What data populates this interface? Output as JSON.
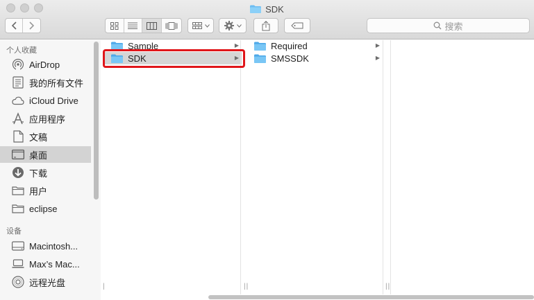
{
  "window": {
    "title": "SDK"
  },
  "toolbar": {
    "back_icon": "chevron-left-icon",
    "forward_icon": "chevron-right-icon",
    "view_modes": [
      "icon-view",
      "list-view",
      "column-view",
      "cover-flow-view"
    ],
    "active_view": "column-view",
    "search_placeholder": "搜索"
  },
  "sidebar": {
    "favorites_header": "个人收藏",
    "favorites": [
      {
        "label": "AirDrop",
        "icon": "airdrop-icon"
      },
      {
        "label": "我的所有文件",
        "icon": "all-files-icon"
      },
      {
        "label": "iCloud Drive",
        "icon": "cloud-icon"
      },
      {
        "label": "应用程序",
        "icon": "applications-icon"
      },
      {
        "label": "文稿",
        "icon": "document-icon"
      },
      {
        "label": "桌面",
        "icon": "desktop-icon",
        "selected": true
      },
      {
        "label": "下载",
        "icon": "download-icon"
      },
      {
        "label": "用户",
        "icon": "folder-icon"
      },
      {
        "label": "eclipse",
        "icon": "folder-icon"
      }
    ],
    "devices_header": "设备",
    "devices": [
      {
        "label": "Macintosh...",
        "icon": "hard-drive-icon"
      },
      {
        "label": "Max’s Mac...",
        "icon": "computer-icon"
      },
      {
        "label": "远程光盘",
        "icon": "disc-icon"
      }
    ]
  },
  "columns": [
    {
      "items": [
        {
          "label": "Sample",
          "has_children": true
        },
        {
          "label": "SDK",
          "has_children": true,
          "selected": true
        }
      ]
    },
    {
      "items": [
        {
          "label": "Required",
          "has_children": true
        },
        {
          "label": "SMSSDK",
          "has_children": true
        }
      ]
    },
    {
      "items": []
    }
  ],
  "colors": {
    "folder": "#5fb6f0",
    "highlight": "#e0161a",
    "selection": "#d5d5d5"
  }
}
